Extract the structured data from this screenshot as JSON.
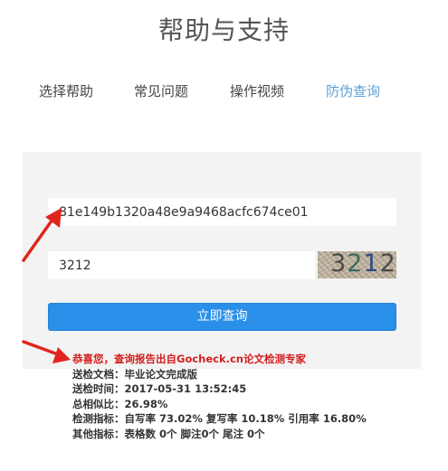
{
  "page": {
    "title": "帮助与支持"
  },
  "tabs": [
    {
      "label": "选择帮助",
      "active": false
    },
    {
      "label": "常见问题",
      "active": false
    },
    {
      "label": "操作视频",
      "active": false
    },
    {
      "label": "防伪查询",
      "active": true
    }
  ],
  "form": {
    "report_code_value": "81e149b1320a48e9a9468acfc674ce01",
    "captcha_value": "3212",
    "captcha_image_text": "3212",
    "submit_label": "立即查询"
  },
  "result": {
    "message": "恭喜您，查询报告出自Gocheck.cn论文检测专家",
    "document": "送检文档：毕业论文完成版",
    "time": "送检时间：2017-05-31 13:52:45",
    "similarity": "总相似比：26.98%",
    "metrics": "检测指标：自写率 73.02% 复写率 10.18% 引用率 16.80%",
    "other_metrics": "其他指标：表格数 0个 脚注0个 尾注 0个"
  },
  "colors": {
    "accent": "#5fa0d6",
    "button": "#2a8fe8",
    "highlight": "#d42020"
  },
  "icons": {
    "annotation": "red-arrow-icon"
  }
}
